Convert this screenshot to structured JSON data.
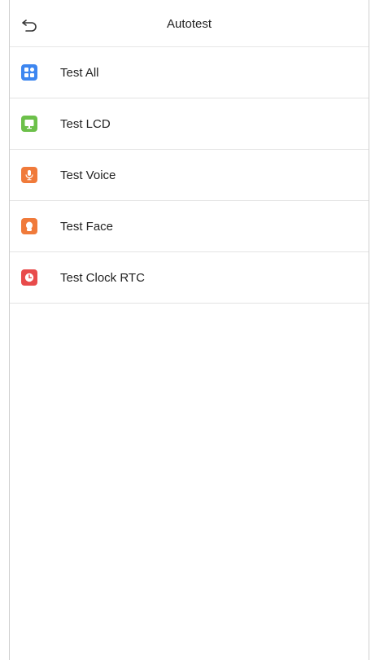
{
  "header": {
    "title": "Autotest",
    "back_icon": "back-arrow-icon"
  },
  "items": [
    {
      "label": "Test All",
      "icon": "grid-icon",
      "color": "#3d86f0"
    },
    {
      "label": "Test LCD",
      "icon": "monitor-icon",
      "color": "#6cc04a"
    },
    {
      "label": "Test Voice",
      "icon": "microphone-icon",
      "color": "#f07a3a"
    },
    {
      "label": "Test Face",
      "icon": "face-icon",
      "color": "#f07a3a"
    },
    {
      "label": "Test Clock RTC",
      "icon": "clock-icon",
      "color": "#e84b4b"
    }
  ]
}
